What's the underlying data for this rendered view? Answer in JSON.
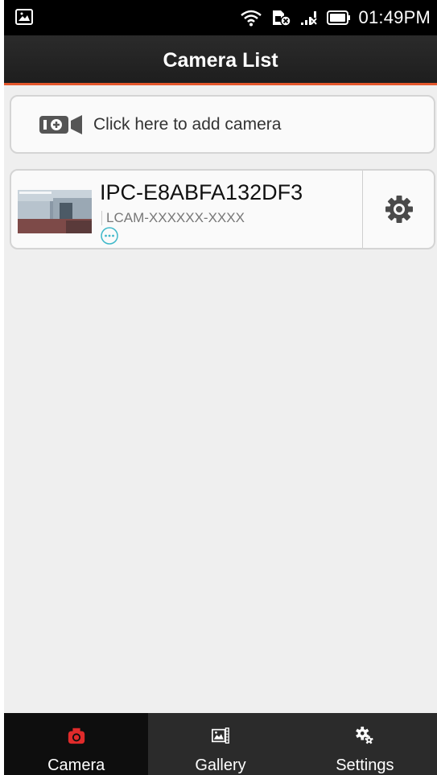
{
  "status_bar": {
    "time": "01:49PM",
    "icons": [
      "gallery-notification-icon",
      "wifi-icon",
      "sim-error-icon",
      "signal-icon",
      "battery-icon"
    ]
  },
  "header": {
    "title": "Camera List"
  },
  "add_camera": {
    "label": "Click here to add camera",
    "icon": "video-camera-add-icon"
  },
  "cameras": [
    {
      "name": "IPC-E8ABFA132DF3",
      "uid": "LCAM-XXXXXX-XXXX",
      "status_icon": "more-dots-icon",
      "settings_icon": "gear-icon"
    }
  ],
  "bottom_nav": {
    "tabs": [
      {
        "label": "Camera",
        "icon": "camera-icon",
        "active": true
      },
      {
        "label": "Gallery",
        "icon": "gallery-icon",
        "active": false
      },
      {
        "label": "Settings",
        "icon": "gears-icon",
        "active": false
      }
    ]
  },
  "colors": {
    "accent": "#e4572c",
    "active_tab_icon": "#e02b2b",
    "status_icon": "#3fb8c9"
  }
}
